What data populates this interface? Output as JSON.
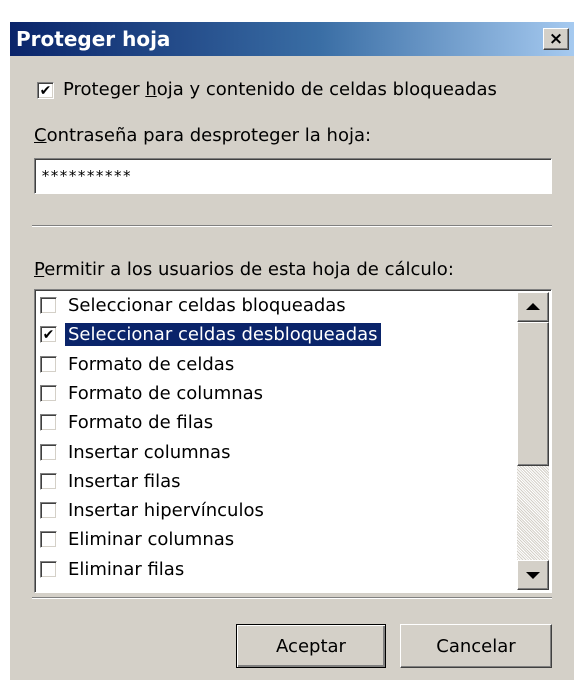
{
  "dialog": {
    "title": "Proteger hoja",
    "close_glyph": "×"
  },
  "protect": {
    "checked": true,
    "label_prefix": "Proteger ",
    "label_accel": "h",
    "label_suffix": "oja y contenido de celdas bloqueadas"
  },
  "password": {
    "label_accel": "C",
    "label_rest": "ontraseña para desproteger la hoja:",
    "value": "**********"
  },
  "permissions": {
    "label_accel": "P",
    "label_rest": "ermitir a los usuarios de esta hoja de cálculo:",
    "items": [
      {
        "label": "Seleccionar celdas bloqueadas",
        "checked": false,
        "selected": false
      },
      {
        "label": "Seleccionar celdas desbloqueadas",
        "checked": true,
        "selected": true
      },
      {
        "label": "Formato de celdas",
        "checked": false,
        "selected": false
      },
      {
        "label": "Formato de columnas",
        "checked": false,
        "selected": false
      },
      {
        "label": "Formato de filas",
        "checked": false,
        "selected": false
      },
      {
        "label": "Insertar columnas",
        "checked": false,
        "selected": false
      },
      {
        "label": "Insertar filas",
        "checked": false,
        "selected": false
      },
      {
        "label": "Insertar hipervínculos",
        "checked": false,
        "selected": false
      },
      {
        "label": "Eliminar columnas",
        "checked": false,
        "selected": false
      },
      {
        "label": "Eliminar filas",
        "checked": false,
        "selected": false
      }
    ]
  },
  "buttons": {
    "ok_label": "Aceptar",
    "cancel_label": "Cancelar"
  },
  "icons": {
    "check": "✔",
    "close": "close-icon",
    "scroll_up": "arrow-up-icon",
    "scroll_down": "arrow-down-icon"
  },
  "colors": {
    "title_start": "#0a246a",
    "title_end": "#a6caf0",
    "face": "#d4d0c8",
    "selection": "#0a246a"
  }
}
